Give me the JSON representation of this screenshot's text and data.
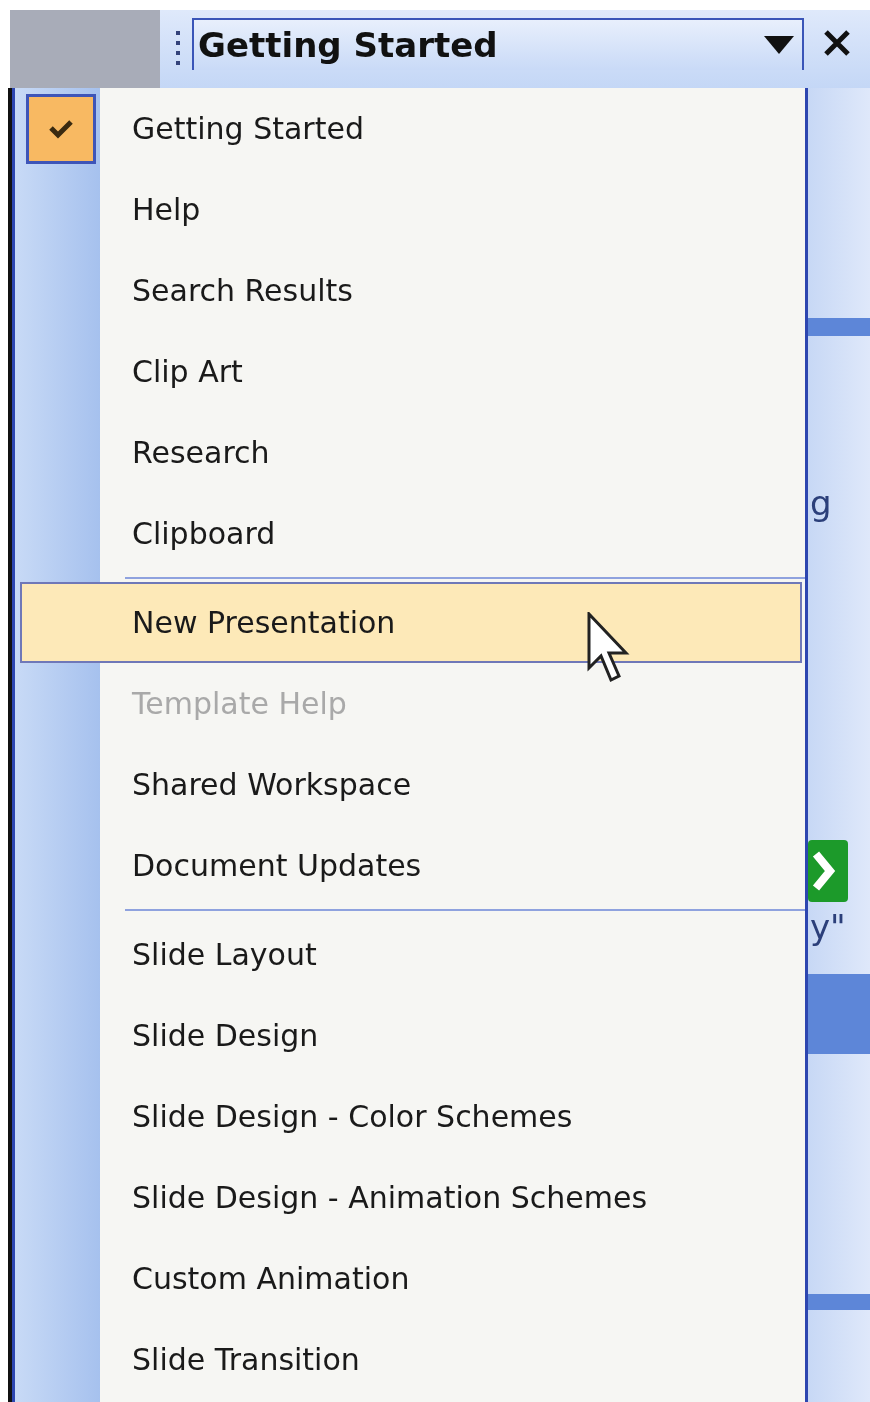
{
  "task_pane": {
    "title": "Getting Started",
    "behind_text": [
      "g",
      "y\""
    ]
  },
  "menu": {
    "groups": [
      [
        {
          "label": "Getting Started",
          "checked": true,
          "highlighted": false,
          "disabled": false
        },
        {
          "label": "Help",
          "checked": false,
          "highlighted": false,
          "disabled": false
        },
        {
          "label": "Search Results",
          "checked": false,
          "highlighted": false,
          "disabled": false
        },
        {
          "label": "Clip Art",
          "checked": false,
          "highlighted": false,
          "disabled": false
        },
        {
          "label": "Research",
          "checked": false,
          "highlighted": false,
          "disabled": false
        },
        {
          "label": "Clipboard",
          "checked": false,
          "highlighted": false,
          "disabled": false
        }
      ],
      [
        {
          "label": "New Presentation",
          "checked": false,
          "highlighted": true,
          "disabled": false
        },
        {
          "label": "Template Help",
          "checked": false,
          "highlighted": false,
          "disabled": true
        },
        {
          "label": "Shared Workspace",
          "checked": false,
          "highlighted": false,
          "disabled": false
        },
        {
          "label": "Document Updates",
          "checked": false,
          "highlighted": false,
          "disabled": false
        }
      ],
      [
        {
          "label": "Slide Layout",
          "checked": false,
          "highlighted": false,
          "disabled": false
        },
        {
          "label": "Slide Design",
          "checked": false,
          "highlighted": false,
          "disabled": false
        },
        {
          "label": "Slide Design - Color Schemes",
          "checked": false,
          "highlighted": false,
          "disabled": false
        },
        {
          "label": "Slide Design - Animation Schemes",
          "checked": false,
          "highlighted": false,
          "disabled": false
        },
        {
          "label": "Custom Animation",
          "checked": false,
          "highlighted": false,
          "disabled": false
        },
        {
          "label": "Slide Transition",
          "checked": false,
          "highlighted": false,
          "disabled": false
        }
      ]
    ]
  }
}
